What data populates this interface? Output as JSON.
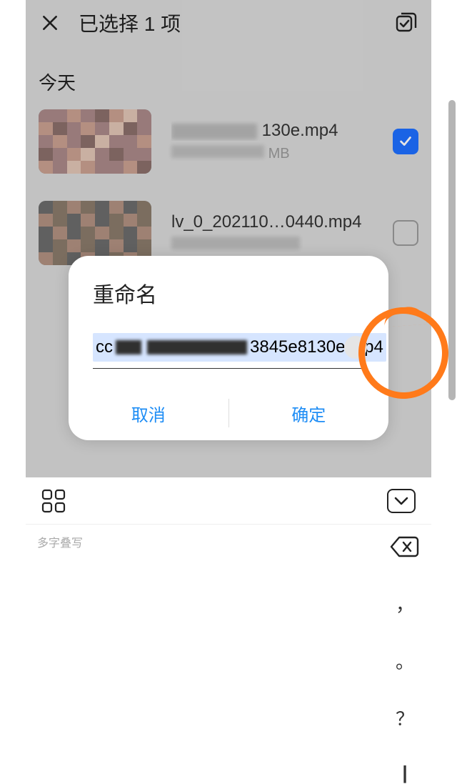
{
  "header": {
    "title": "已选择 1 项"
  },
  "section": {
    "today": "今天"
  },
  "files": [
    {
      "name_suffix": "130e.mp4",
      "meta_suffix": "MB",
      "checked": true
    },
    {
      "name": "lv_0_202110…0440.mp4",
      "meta": "",
      "checked": false
    }
  ],
  "dialog": {
    "title": "重命名",
    "input_visible_prefix": "cc",
    "input_visible_suffix": "3845e8130e.mp4",
    "cancel": "取消",
    "confirm": "确定"
  },
  "keyboard": {
    "mode_label": "多字叠写",
    "punct": [
      "，",
      "。",
      "？"
    ]
  }
}
